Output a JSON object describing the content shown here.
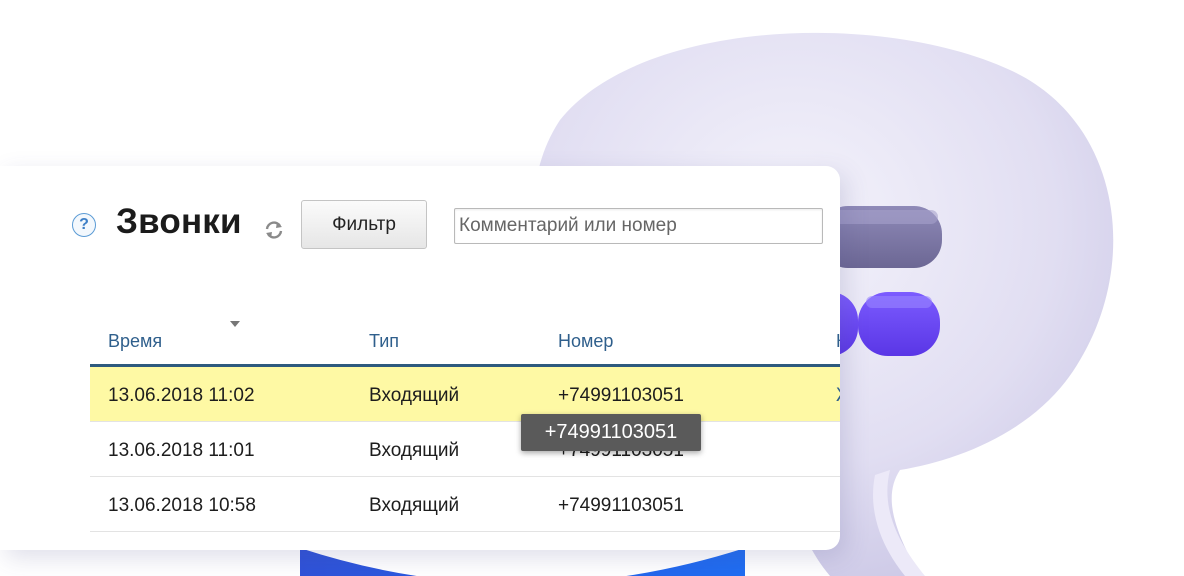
{
  "header": {
    "help_icon_glyph": "?",
    "title": "Звонки",
    "filter_label": "Фильтр",
    "search_placeholder": "Комментарий или номер"
  },
  "table": {
    "columns": [
      "Время",
      "Тип",
      "Номер",
      "К"
    ],
    "sort_column": "Время",
    "sort_direction": "descending",
    "rows": [
      {
        "time": "13.06.2018 11:02",
        "type": "Входящий",
        "number": "+74991103051",
        "extra": "Ж",
        "highlighted": true
      },
      {
        "time": "13.06.2018 11:01",
        "type": "Входящий",
        "number": "+74991103051",
        "extra": "",
        "highlighted": false
      },
      {
        "time": "13.06.2018 10:58",
        "type": "Входящий",
        "number": "+74991103051",
        "extra": "",
        "highlighted": false
      }
    ]
  },
  "tooltip": {
    "text": "+74991103051"
  },
  "colors": {
    "title": "#1b1b1b",
    "column_header": "#2f5f8c",
    "header_rule": "#2e5a7e",
    "row_highlight": "#fef9a4",
    "tooltip_bg": "#5a5a5a",
    "bubble": "#dcdaf0",
    "bubble_accent": "#6c4cf0"
  },
  "icons": [
    "question-icon",
    "refresh-icon",
    "sort-down-icon",
    "chat-bubble-illustration"
  ]
}
